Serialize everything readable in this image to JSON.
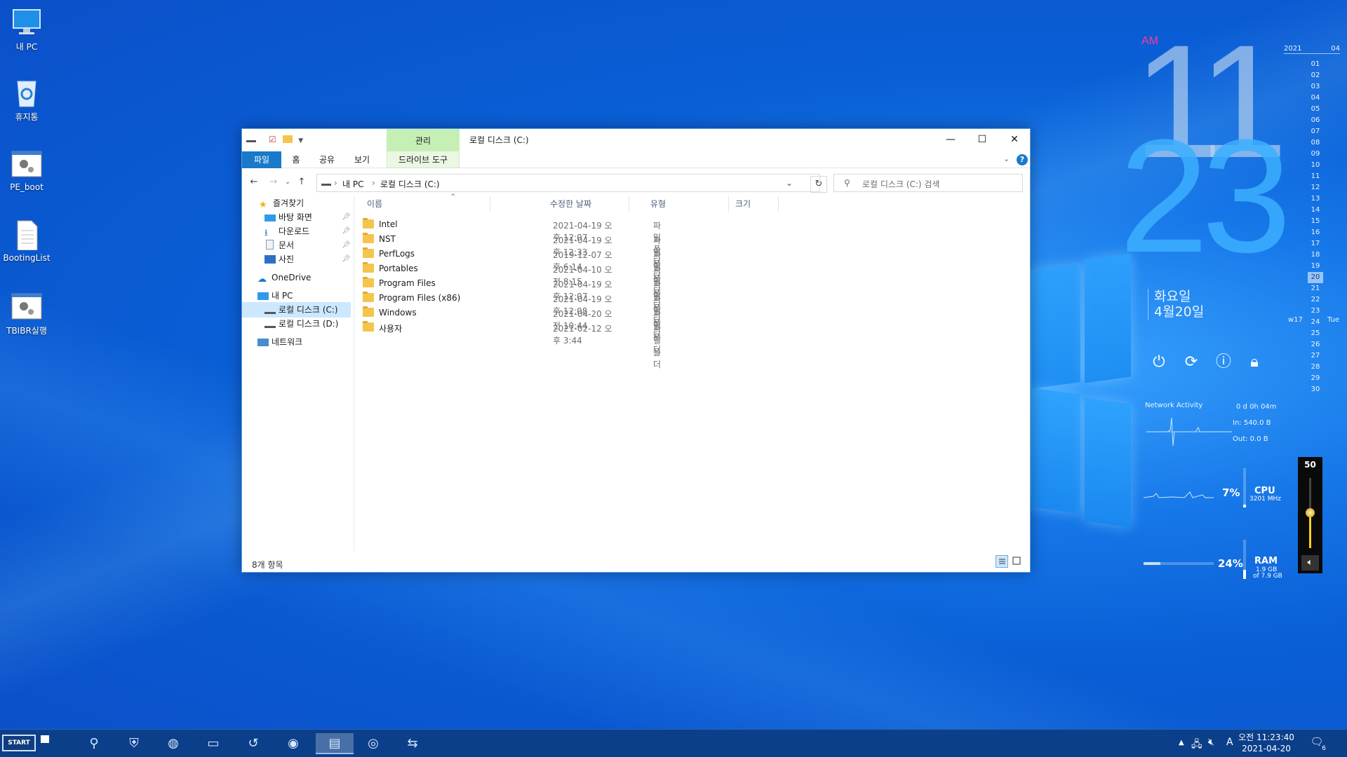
{
  "desktop": {
    "icons": [
      {
        "label": "내 PC",
        "icon": "monitor-icon"
      },
      {
        "label": "휴지통",
        "icon": "recycle-bin-icon"
      },
      {
        "label": "PE_boot",
        "icon": "settings-app-icon"
      },
      {
        "label": "BootingList",
        "icon": "text-file-icon"
      },
      {
        "label": "TBIBR실행",
        "icon": "settings-app-icon"
      }
    ]
  },
  "clock": {
    "ampm": "AM",
    "hour": "11",
    "minute": "23",
    "weekday": "화요일",
    "date": "4월20일",
    "ampm_color": "#ff3aa0"
  },
  "calendar": {
    "year": "2021",
    "month": "04",
    "days": [
      "01",
      "02",
      "03",
      "04",
      "05",
      "06",
      "07",
      "08",
      "09",
      "10",
      "11",
      "12",
      "13",
      "14",
      "15",
      "16",
      "17",
      "18",
      "19",
      "20",
      "21",
      "22",
      "23",
      "24",
      "25",
      "26",
      "27",
      "28",
      "29",
      "30"
    ],
    "today": "20",
    "week": "w17",
    "dow": "Tue"
  },
  "power_buttons": [
    "power-icon",
    "restart-icon",
    "shutdown-icon",
    "lock-icon"
  ],
  "stats": {
    "network_label": "Network Activity",
    "uptime": "0 d 0h 04m",
    "net_in": "In: 540.0 B",
    "net_out": "Out: 0.0 B",
    "cpu_pct": "7%",
    "cpu_name": "CPU",
    "cpu_freq": "3201 MHz",
    "ram_pct": "24%",
    "ram_name": "RAM",
    "ram_used": "1.9 GB",
    "ram_total": "of 7.9 GB",
    "cpu_fraction": 0.07,
    "ram_fraction": 0.24
  },
  "volume": {
    "level": "50",
    "fraction": 0.5
  },
  "explorer": {
    "title": "로컬 디스크 (C:)",
    "context_tab": "관리",
    "ribbon_tabs": [
      "파일",
      "홈",
      "공유",
      "보기",
      "드라이브 도구"
    ],
    "address": {
      "root": "내 PC",
      "current": "로컬 디스크 (C:)"
    },
    "search_placeholder": "로컬 디스크 (C:) 검색",
    "nav": {
      "quick_access": "즐겨찾기",
      "quick_items": [
        "바탕 화면",
        "다운로드",
        "문서",
        "사진"
      ],
      "onedrive": "OneDrive",
      "this_pc": "내 PC",
      "drives": [
        "로컬 디스크 (C:)",
        "로컬 디스크 (D:)"
      ],
      "network": "네트워크"
    },
    "columns": [
      "이름",
      "수정한 날짜",
      "유형",
      "크기"
    ],
    "files": [
      {
        "name": "Intel",
        "date": "2021-04-19 오후 12:07",
        "type": "파일 폴더"
      },
      {
        "name": "NST",
        "date": "2021-04-19 오후 12:33",
        "type": "파일 폴더"
      },
      {
        "name": "PerfLogs",
        "date": "2019-12-07 오후 6:14",
        "type": "파일 폴더"
      },
      {
        "name": "Portables",
        "date": "2021-04-10 오전 8:15",
        "type": "파일 폴더"
      },
      {
        "name": "Program Files",
        "date": "2021-04-19 오후 12:07",
        "type": "파일 폴더"
      },
      {
        "name": "Program Files (x86)",
        "date": "2021-04-19 오후 12:08",
        "type": "파일 폴더"
      },
      {
        "name": "Windows",
        "date": "2021-04-20 오전 10:44",
        "type": "파일 폴더"
      },
      {
        "name": "사용자",
        "date": "2021-02-12 오후 3:44",
        "type": "파일 폴더"
      }
    ],
    "status": "8개 항목"
  },
  "taskbar": {
    "start_label": "START",
    "time": "오전 11:23:40",
    "date": "2021-04-20",
    "tray_ime": "A",
    "notification_count": "6"
  }
}
